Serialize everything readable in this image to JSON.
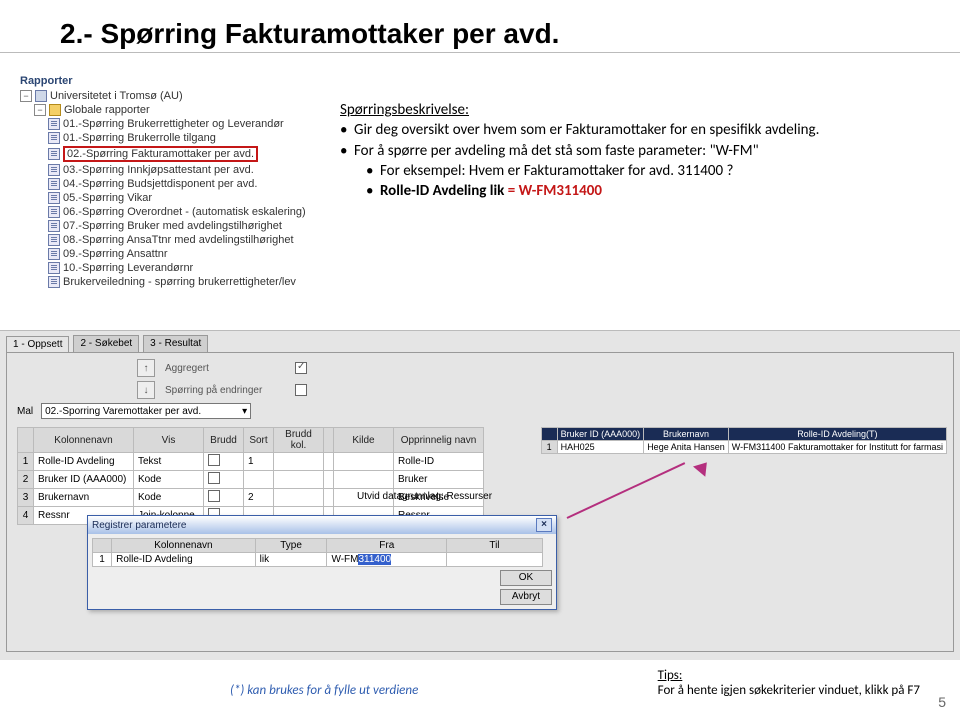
{
  "slide": {
    "title": "2.- Spørring Fakturamottaker per avd.",
    "page_number": "5"
  },
  "tree": {
    "header": "Rapporter",
    "root": "Universitetet i Tromsø (AU)",
    "folder": "Globale rapporter",
    "items": [
      "01.-Spørring Brukerrettigheter og Leverandør",
      "01.-Spørring Brukerrolle tilgang",
      "02.-Spørring Fakturamottaker per avd.",
      "03.-Spørring Innkjøpsattestant per avd.",
      "04.-Spørring Budsjettdisponent per avd.",
      "05.-Spørring Vikar",
      "06.-Spørring Overordnet - (automatisk eskalering)",
      "07.-Spørring Bruker med avdelingstilhørighet",
      "08.-Spørring AnsaTtnr med avdelingstilhørighet",
      "09.-Spørring Ansattnr",
      "10.-Spørring Leverandørnr",
      "Brukerveiledning - spørring brukerrettigheter/lev"
    ],
    "highlighted_index": 2
  },
  "description": {
    "heading": "Spørringsbeskrivelse:",
    "bullet1": "Gir deg oversikt over hvem som er Fakturamottaker for en spesifikk avdeling.",
    "bullet2_pre": "For å spørre per avdeling må det stå som faste parameter: ",
    "bullet2_q": "\"W-FM\"",
    "sub1": "For eksempel:  Hvem er Fakturamottaker for avd. 311400 ?",
    "sub2_label": "Rolle-ID Avdeling lik",
    "sub2_value": "= W-FM311400"
  },
  "tabs": {
    "t1": "1 - Oppsett",
    "t2": "2 - Søkebet",
    "t3": "3 - Resultat"
  },
  "sort": {
    "label_aggregert": "Aggregert",
    "label_endringer": "Spørring på endringer",
    "aggregert_checked": true,
    "endringer_checked": false
  },
  "mal": {
    "label": "Mal",
    "value": "02.-Sporring Varemottaker per avd."
  },
  "grid": {
    "headers": [
      "",
      "Kolonnenavn",
      "Vis",
      "Brudd",
      "Sort",
      "Brudd kol.",
      "",
      "Kilde",
      "Opprinnelig navn"
    ],
    "rows": [
      [
        "1",
        "Rolle-ID Avdeling",
        "Tekst",
        "",
        "1",
        "",
        "",
        "",
        "Rolle-ID"
      ],
      [
        "2",
        "Bruker ID (AAA000)",
        "Kode",
        "",
        "",
        "",
        "",
        "",
        "Bruker"
      ],
      [
        "3",
        "Brukernavn",
        "Kode",
        "",
        "2",
        "",
        "",
        "",
        "Beskrivelse"
      ],
      [
        "4",
        "Ressnr",
        "Join-kolonne",
        "",
        "",
        "",
        "",
        "",
        "Ressnr"
      ]
    ]
  },
  "utvid_label": "Utvid datagrunnlag: Ressurser",
  "popup": {
    "title": "Registrer parametere",
    "close_x": "×",
    "headers": [
      "",
      "Kolonnenavn",
      "Type",
      "Fra",
      "Til"
    ],
    "row": [
      "1",
      "Rolle-ID Avdeling",
      "lik",
      "W-FM311400",
      ""
    ],
    "selected_text": "311400",
    "btn_ok": "OK",
    "btn_cancel": "Avbryt"
  },
  "result": {
    "headers": [
      "",
      "Bruker ID (AAA000)",
      "Brukernavn",
      "Rolle-ID Avdeling(T)"
    ],
    "row": [
      "1",
      "HAH025",
      "Hege Anita Hansen",
      "W-FM311400 Fakturamottaker for Institutt for farmasi"
    ]
  },
  "footnote": "(*) kan brukes for å fylle ut  verdiene",
  "tips": {
    "label": "Tips:",
    "text": "For å hente igjen søkekriterier vinduet, klikk på F7"
  }
}
